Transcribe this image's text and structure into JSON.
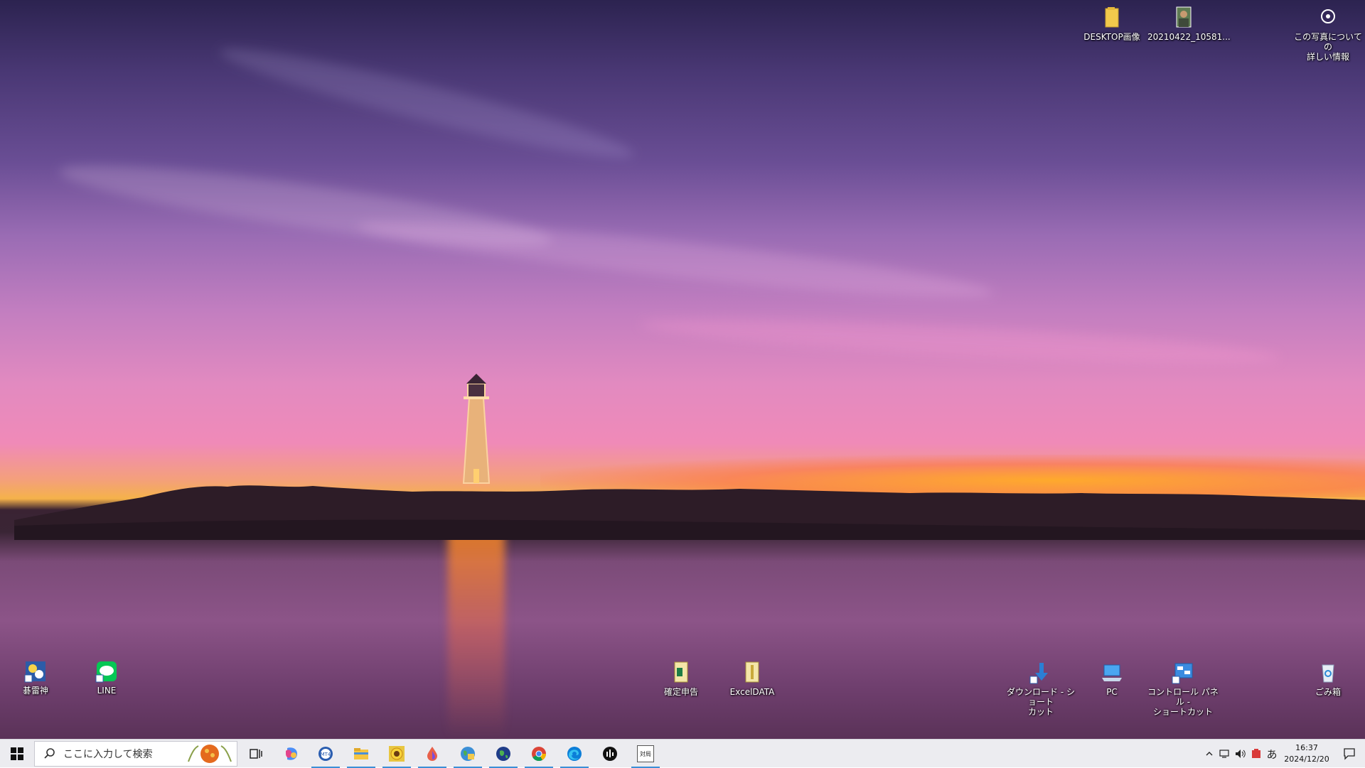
{
  "desktop_icons": {
    "desktop_images": "DESKTOP画像",
    "photo_file": "20210422_10581...",
    "photo_info": "この写真についての\n詳しい情報",
    "igo_app": "碁雷神",
    "line": "LINE",
    "tax_return": "確定申告",
    "excel_data": "ExcelDATA",
    "downloads_shortcut": "ダウンロード - ショート\nカット",
    "pc": "PC",
    "control_panel_shortcut": "コントロール パネル -\nショートカット",
    "recycle_bin": "ごみ箱"
  },
  "taskbar": {
    "search_placeholder": "ここに入力して検索",
    "apps": [
      {
        "name": "task-view"
      },
      {
        "name": "copilot"
      },
      {
        "name": "mt4"
      },
      {
        "name": "file-explorer"
      },
      {
        "name": "sunflower-app"
      },
      {
        "name": "droplet-app"
      },
      {
        "name": "globe-app-1"
      },
      {
        "name": "globe-app-2"
      },
      {
        "name": "chrome"
      },
      {
        "name": "edge"
      },
      {
        "name": "stock-app"
      },
      {
        "name": "taikyoku-app"
      }
    ],
    "taikyoku_label": "対局",
    "ime": "あ",
    "time": "16:37",
    "date": "2024/12/20"
  },
  "colors": {
    "taskbar_bg": "#ececf0",
    "running_indicator": "#3b8fd6",
    "desktop_text": "#ffffff"
  }
}
